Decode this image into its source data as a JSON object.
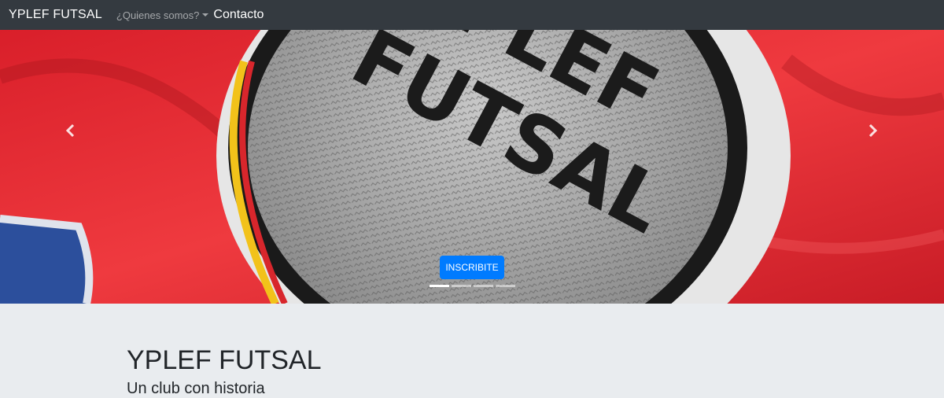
{
  "navbar": {
    "brand": "YPLEF FUTSAL",
    "dropdown_label": "¿Quienes somos?",
    "contact_label": "Contacto"
  },
  "carousel": {
    "button_label": "INSCRIBITE",
    "patch_text_line1": "YPLEF",
    "patch_text_line2": "FUTSAL",
    "indicators": 4,
    "active_indicator": 1,
    "icons": [
      "chevron-left-icon",
      "chevron-right-icon"
    ]
  },
  "jumbotron": {
    "title": "YPLEF FUTSAL",
    "subtitle": "Un club con historia"
  },
  "colors": {
    "navbar": "#343a40",
    "primary": "#007bff",
    "jersey_red": "#e3222b",
    "jumbotron_bg": "#e9ecef"
  }
}
